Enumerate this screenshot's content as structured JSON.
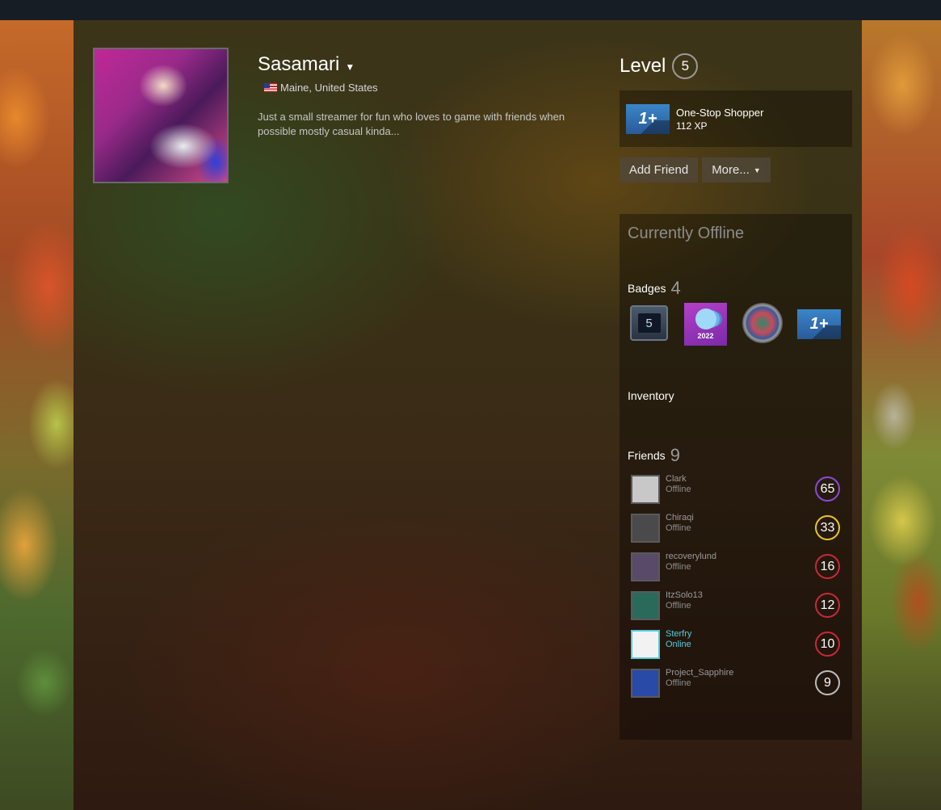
{
  "profile": {
    "name": "Sasamari",
    "location": "Maine, United States",
    "summary": "Just a small streamer for fun who loves to game with friends when possible mostly casual kinda..."
  },
  "level": {
    "label": "Level",
    "value": "5"
  },
  "favorite_badge": {
    "icon_text": "1+",
    "name": "One-Stop Shopper",
    "xp": "112 XP"
  },
  "actions": {
    "add_friend": "Add Friend",
    "more": "More..."
  },
  "status": "Currently Offline",
  "badges": {
    "title": "Badges",
    "count": "4",
    "items": [
      {
        "name": "level-5-badge-icon",
        "text": "5"
      },
      {
        "name": "steam-replay-2022-badge-icon",
        "text": "2022"
      },
      {
        "name": "disc-badge-icon",
        "text": ""
      },
      {
        "name": "one-stop-shopper-badge-icon",
        "text": "1+"
      }
    ]
  },
  "inventory": {
    "title": "Inventory"
  },
  "friends": {
    "title": "Friends",
    "count": "9",
    "list": [
      {
        "name": "Clark",
        "status": "Offline",
        "level": "65",
        "level_color": "#8a4ad8",
        "online": false,
        "avatar_color": "#c8c8c8"
      },
      {
        "name": "Chiraqi",
        "status": "Offline",
        "level": "33",
        "level_color": "#e8c22a",
        "online": false,
        "avatar_color": "#4a4a4a"
      },
      {
        "name": "recoverylund",
        "status": "Offline",
        "level": "16",
        "level_color": "#c8283a",
        "online": false,
        "avatar_color": "#5a4a6a"
      },
      {
        "name": "ItzSolo13",
        "status": "Offline",
        "level": "12",
        "level_color": "#c8283a",
        "online": false,
        "avatar_color": "#2a6a5a"
      },
      {
        "name": "Sterfry",
        "status": "Online",
        "level": "10",
        "level_color": "#c8283a",
        "online": true,
        "avatar_color": "#f2f2f2"
      },
      {
        "name": "Project_Sapphire",
        "status": "Offline",
        "level": "9",
        "level_color": "#bcbcbc",
        "online": false,
        "avatar_color": "#2a4aa8"
      }
    ]
  },
  "colors": {
    "topbar": "#171d25",
    "online": "#57cbde",
    "offline": "#8c8c8c"
  }
}
